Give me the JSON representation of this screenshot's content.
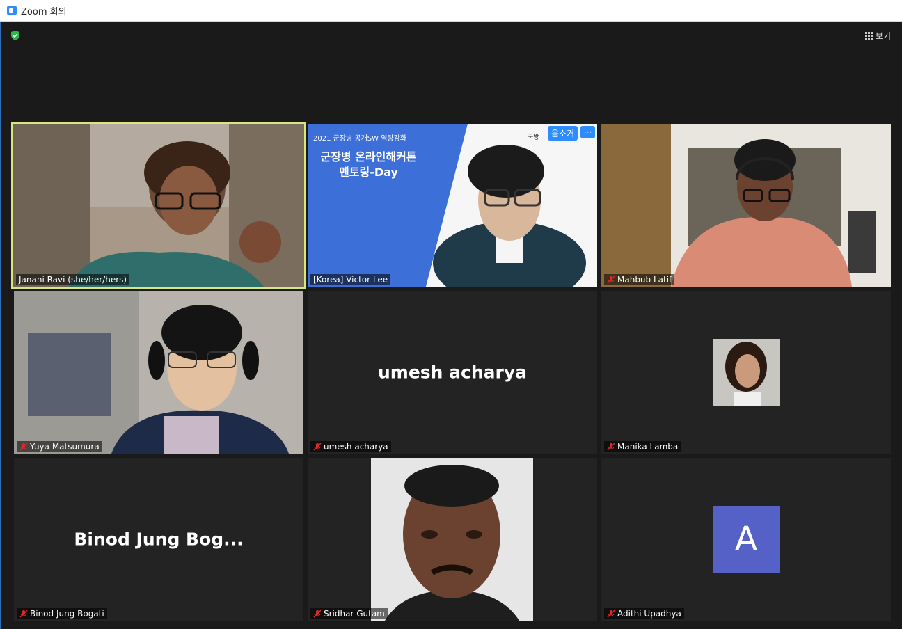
{
  "window": {
    "title": "Zoom 회의"
  },
  "toolbar": {
    "view_label": "보기"
  },
  "tiles": [
    {
      "name": "Janani Ravi (she/her/hers)",
      "muted": false,
      "speaking": true
    },
    {
      "name": "[Korea] Victor Lee",
      "muted": false,
      "shared_slide": {
        "line1": "2021 군장병 공개SW 역량강화",
        "line2": "군장병 온라인해커톤",
        "line3": "멘토링-Day",
        "corner": "국방"
      },
      "buttons": {
        "unmute": "음소거",
        "more": "···"
      }
    },
    {
      "name": "Mahbub Latif",
      "muted": true
    },
    {
      "name": "Yuya Matsumura",
      "muted": true
    },
    {
      "name": "umesh acharya",
      "muted": true,
      "display_name": "umesh acharya"
    },
    {
      "name": "Manika Lamba",
      "muted": true
    },
    {
      "name": "Binod Jung Bogati",
      "muted": true,
      "display_name": "Binod Jung Bog..."
    },
    {
      "name": "Sridhar Gutam",
      "muted": true
    },
    {
      "name": "Adithi Upadhya",
      "muted": true,
      "avatar_letter": "A"
    }
  ],
  "colors": {
    "active_border": "#d6e87a",
    "avatar_bg": "#5561c7",
    "accent": "#2d8cff",
    "mute_red": "#e02828"
  }
}
